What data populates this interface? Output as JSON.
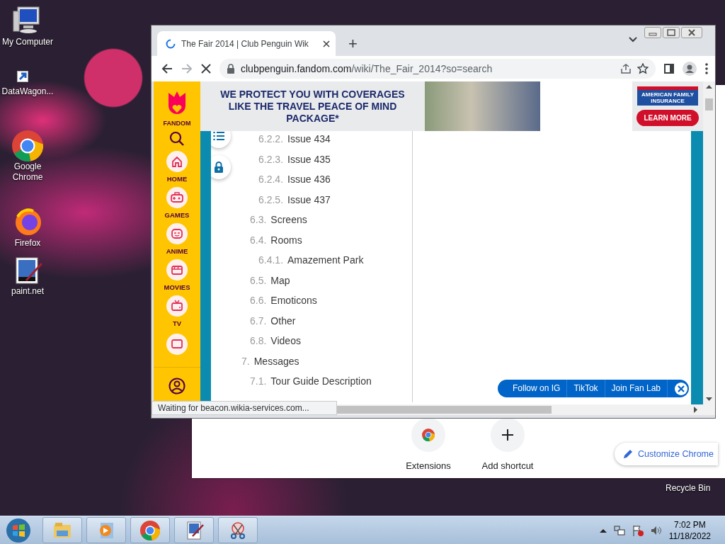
{
  "desktop": {
    "icons": [
      {
        "label": "My Computer",
        "kind": "computer"
      },
      {
        "label": "DataWagon...",
        "kind": "shortcut"
      },
      {
        "label": "Google Chrome",
        "kind": "chrome"
      },
      {
        "label": "Firefox",
        "kind": "firefox"
      },
      {
        "label": "paint.net",
        "kind": "paint"
      }
    ],
    "recycle_bin": {
      "label": "Recycle Bin"
    }
  },
  "background_window": {
    "shortcuts": [
      {
        "label": "Extensions",
        "kind": "chrome"
      },
      {
        "label": "Add shortcut",
        "kind": "add"
      }
    ],
    "customize_button": "Customize Chrome"
  },
  "browser": {
    "tab_title": "The Fair 2014 | Club Penguin Wik",
    "new_tab": "+",
    "url_host": "clubpenguin.fandom.com",
    "url_path": "/wiki/The_Fair_2014?so=search",
    "status_text": "Waiting for beacon.wikia-services.com...",
    "fandom_nav": {
      "brand": "FANDOM",
      "items": [
        {
          "label": "HOME",
          "kind": "home"
        },
        {
          "label": "GAMES",
          "kind": "games"
        },
        {
          "label": "ANIME",
          "kind": "anime"
        },
        {
          "label": "MOVIES",
          "kind": "movies"
        },
        {
          "label": "TV",
          "kind": "tv"
        }
      ]
    },
    "ad": {
      "headline": "WE PROTECT YOU WITH COVERAGES LIKE THE TRAVEL PEACE OF MIND PACKAGE*",
      "brand": "AMERICAN FAMILY INSURANCE",
      "cta": "LEARN MORE"
    },
    "toc": [
      {
        "children": [
          {
            "children": [
              {
                "number": "6.2.2.",
                "label": "Issue 434"
              },
              {
                "number": "6.2.3.",
                "label": "Issue 435"
              },
              {
                "number": "6.2.4.",
                "label": "Issue 436"
              },
              {
                "number": "6.2.5.",
                "label": "Issue 437"
              }
            ]
          },
          {
            "number": "6.3.",
            "label": "Screens"
          },
          {
            "number": "6.4.",
            "label": "Rooms",
            "children": [
              {
                "number": "6.4.1.",
                "label": "Amazement Park"
              }
            ]
          },
          {
            "number": "6.5.",
            "label": "Map"
          },
          {
            "number": "6.6.",
            "label": "Emoticons"
          },
          {
            "number": "6.7.",
            "label": "Other"
          },
          {
            "number": "6.8.",
            "label": "Videos"
          }
        ]
      },
      {
        "number": "7.",
        "label": "Messages",
        "children": [
          {
            "number": "7.1.",
            "label": "Tour Guide Description"
          }
        ]
      }
    ],
    "social_bar": [
      "Follow on IG",
      "TikTok",
      "Join Fan Lab"
    ]
  },
  "taskbar": {
    "apps": [
      {
        "kind": "explorer"
      },
      {
        "kind": "media"
      },
      {
        "kind": "chrome"
      },
      {
        "kind": "paint"
      },
      {
        "kind": "snip"
      }
    ],
    "time": "7:02 PM",
    "date": "11/18/2022"
  }
}
